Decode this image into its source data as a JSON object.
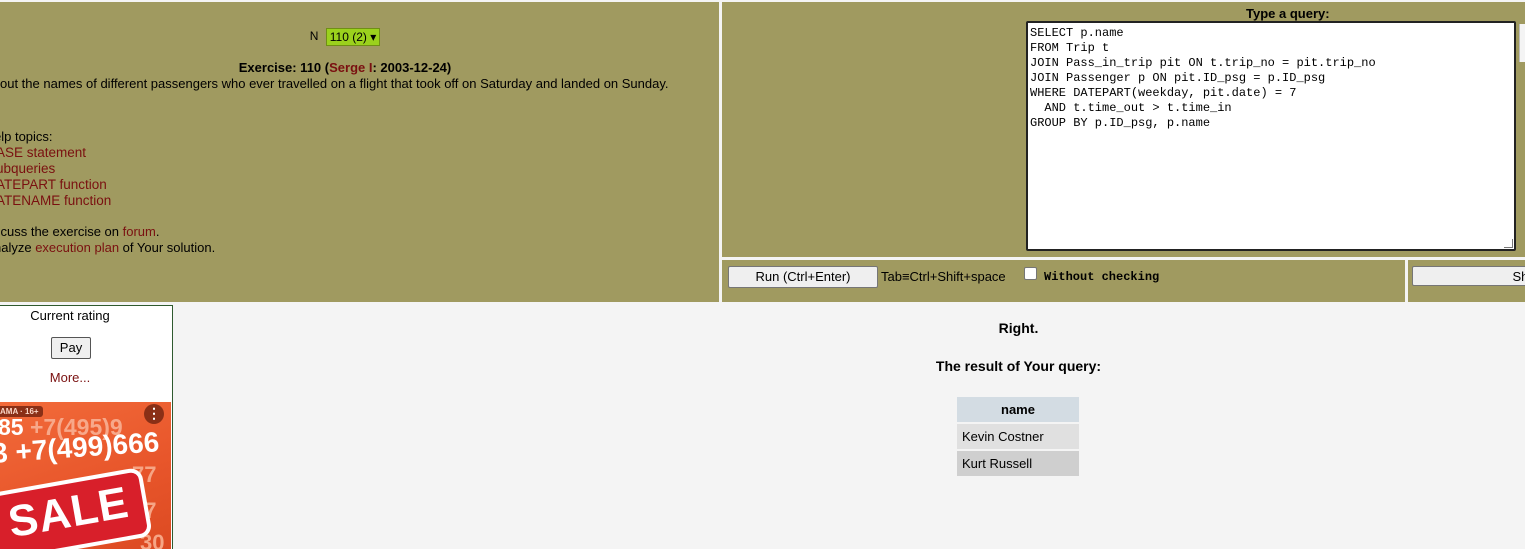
{
  "exercise": {
    "n_label": "N",
    "n_selected": "110 (2)",
    "prefix": "Exercise: 110 (",
    "author": "Serge I",
    "suffix": ": 2003-12-24)",
    "task": " out the names of different passengers who ever travelled on a flight that took off on Saturday and landed on Sunday."
  },
  "help": {
    "title": "elp topics:",
    "links": [
      "ASE statement",
      "ubqueries",
      "ATEPART function",
      "ATENAME function"
    ],
    "discuss_prefix": "scuss the exercise on ",
    "discuss_link": "forum",
    "discuss_suffix": ".",
    "analyze_prefix": "nalyze ",
    "analyze_link": "execution plan",
    "analyze_suffix": " of Your solution."
  },
  "query": {
    "label": "Type a query:",
    "text": "SELECT p.name\nFROM Trip t\nJOIN Pass_in_trip pit ON t.trip_no = pit.trip_no\nJOIN Passenger p ON pit.ID_psg = p.ID_psg\nWHERE DATEPART(weekday, pit.date) = 7\n  AND t.time_out > t.time_in\nGROUP BY p.ID_psg, p.name"
  },
  "controls": {
    "run_label": "Run (Ctrl+Enter)",
    "tab_hint": "Tab≡Ctrl+Shift+space",
    "without_checking": "Without checking",
    "show_label": "Show"
  },
  "sidebar": {
    "rating_label": "Current rating",
    "pay_label": "Pay",
    "more_label": "More..."
  },
  "ad": {
    "age": "AMA · 16+",
    "menu": "⋮",
    "num1_a": "85",
    "num1_b": " +7(495)9",
    "num2": "3 +7(499)666",
    "faded_a": "77",
    "faded_b": "77",
    "faded_c": "30",
    "sale": "SALE"
  },
  "result": {
    "status": "Right.",
    "label": "The result of Your query:",
    "columns": [
      "name"
    ],
    "rows": [
      [
        "Kevin Costner"
      ],
      [
        "Kurt Russell"
      ]
    ]
  }
}
